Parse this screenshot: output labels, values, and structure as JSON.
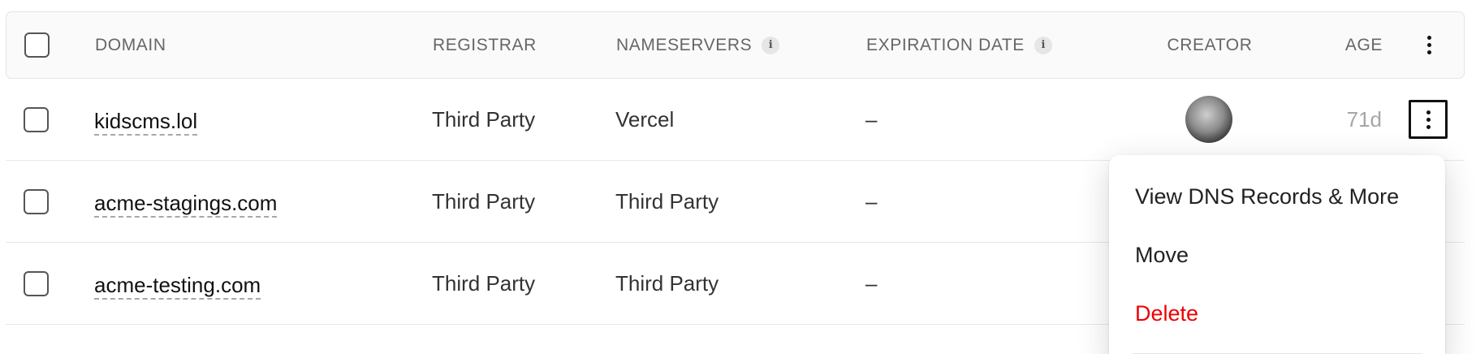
{
  "table": {
    "headers": {
      "domain": "DOMAIN",
      "registrar": "REGISTRAR",
      "nameservers": "NAMESERVERS",
      "expiration": "EXPIRATION DATE",
      "creator": "CREATOR",
      "age": "AGE",
      "info_icon": "i"
    },
    "rows": [
      {
        "domain": "kidscms.lol",
        "registrar": "Third Party",
        "nameservers": "Vercel",
        "expiration": "–",
        "age": "71d"
      },
      {
        "domain": "acme-stagings.com",
        "registrar": "Third Party",
        "nameservers": "Third Party",
        "expiration": "–",
        "age": ""
      },
      {
        "domain": "acme-testing.com",
        "registrar": "Third Party",
        "nameservers": "Third Party",
        "expiration": "–",
        "age": ""
      }
    ]
  },
  "menu": {
    "items": [
      {
        "label": "View DNS Records & More",
        "color": "#222222"
      },
      {
        "label": "Move",
        "color": "#222222"
      },
      {
        "label": "Delete",
        "color": "#ee0000"
      }
    ]
  },
  "icons": {
    "row_menu": "more-vertical-icon",
    "info": "info-icon",
    "checkbox": "checkbox-icon"
  }
}
